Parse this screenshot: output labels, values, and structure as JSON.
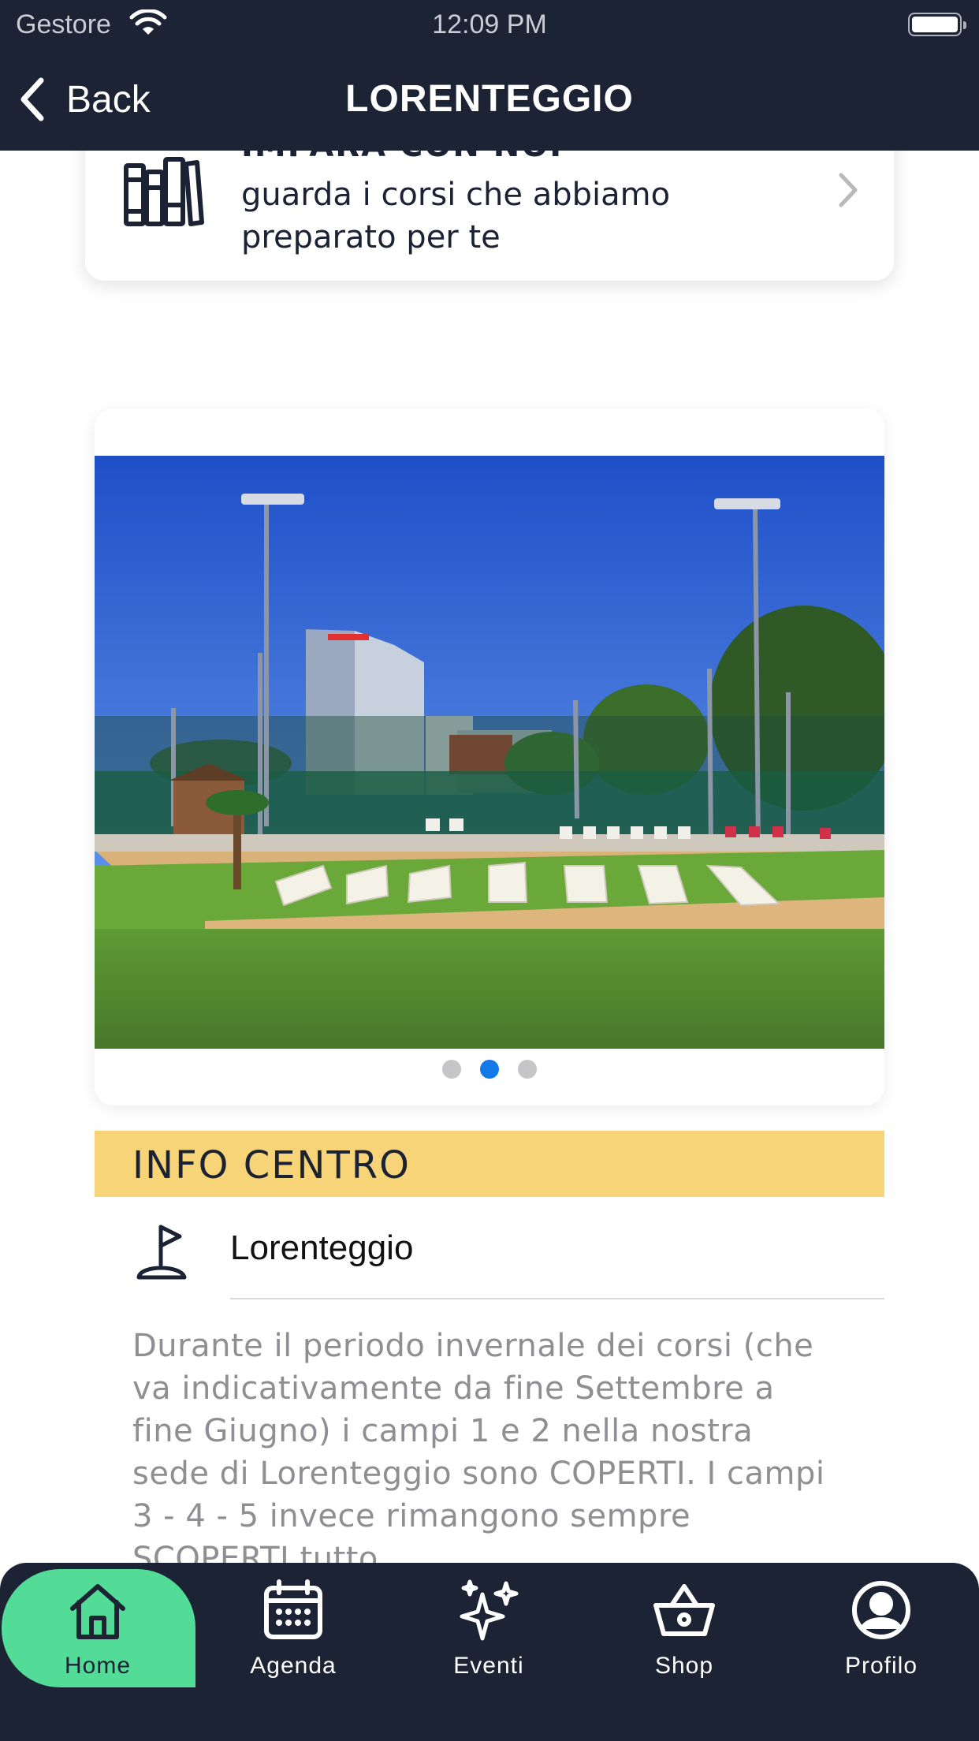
{
  "status_bar": {
    "carrier": "Gestore",
    "time": "12:09 PM"
  },
  "nav": {
    "back_label": "Back",
    "title": "LORENTEGGIO"
  },
  "course_card": {
    "title": "IMPARA CON NOI",
    "subtitle": "guarda i corsi che abbiamo preparato per te",
    "icon": "books-icon"
  },
  "gallery": {
    "page_count": 3,
    "active_index": 1
  },
  "info": {
    "header": "INFO CENTRO",
    "location_name": "Lorenteggio",
    "location_icon": "golf-flag-icon",
    "description": "Durante il periodo invernale dei corsi (che va indicativamente da fine Settembre a fine Giugno) i campi 1 e 2 nella nostra sede di Lorenteggio sono COPERTI. I campi 3 - 4 - 5 invece rimangono sempre SCOPERTI tutto"
  },
  "tabbar": {
    "items": [
      {
        "label": "Home",
        "icon": "home-icon",
        "active": true
      },
      {
        "label": "Agenda",
        "icon": "calendar-icon",
        "active": false
      },
      {
        "label": "Eventi",
        "icon": "sparkles-icon",
        "active": false
      },
      {
        "label": "Shop",
        "icon": "basket-icon",
        "active": false
      },
      {
        "label": "Profilo",
        "icon": "profile-icon",
        "active": false
      }
    ]
  },
  "colors": {
    "navy": "#1b2334",
    "accent_green": "#53dc98",
    "info_yellow": "#f8d479",
    "dot_active": "#1479e8"
  }
}
